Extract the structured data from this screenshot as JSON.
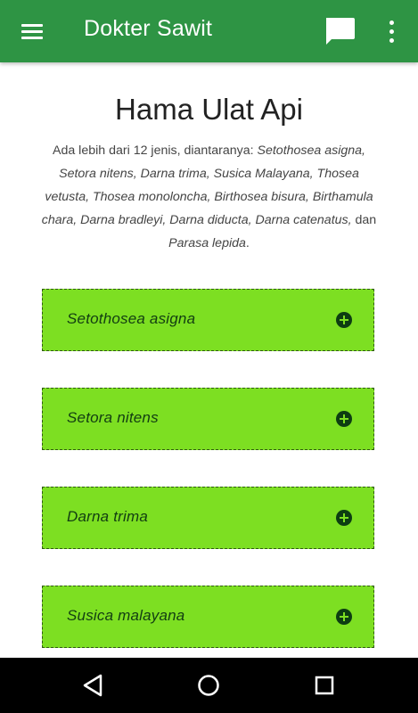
{
  "appbar": {
    "title": "Dokter Sawit",
    "menu_icon": "hamburger-menu-icon",
    "chat_icon": "chat-icon",
    "more_icon": "more-vert-icon",
    "color": "#2e9444"
  },
  "main": {
    "title": "Hama Ulat Api",
    "intro_prefix": "Ada lebih dari 12 jenis, diantaranya: ",
    "intro_species": "Setothosea asigna, Setora nitens, Darna trima, Susica Malayana, Thosea vetusta, Thosea monoloncha, Birthosea bisura, Birthamula chara, Darna bradleyi, Darna diducta, Darna catenatus,",
    "intro_conj": " dan ",
    "intro_last": "Parasa lepida",
    "intro_end": "."
  },
  "accordion": {
    "color": "#7ddf22",
    "icon": "plus-circle-icon",
    "items": [
      {
        "label": "Setothosea asigna"
      },
      {
        "label": "Setora nitens"
      },
      {
        "label": "Darna trima"
      },
      {
        "label": "Susica malayana"
      }
    ]
  },
  "navbar": {
    "back_icon": "back-triangle-icon",
    "home_icon": "home-circle-icon",
    "recents_icon": "recents-square-icon"
  }
}
